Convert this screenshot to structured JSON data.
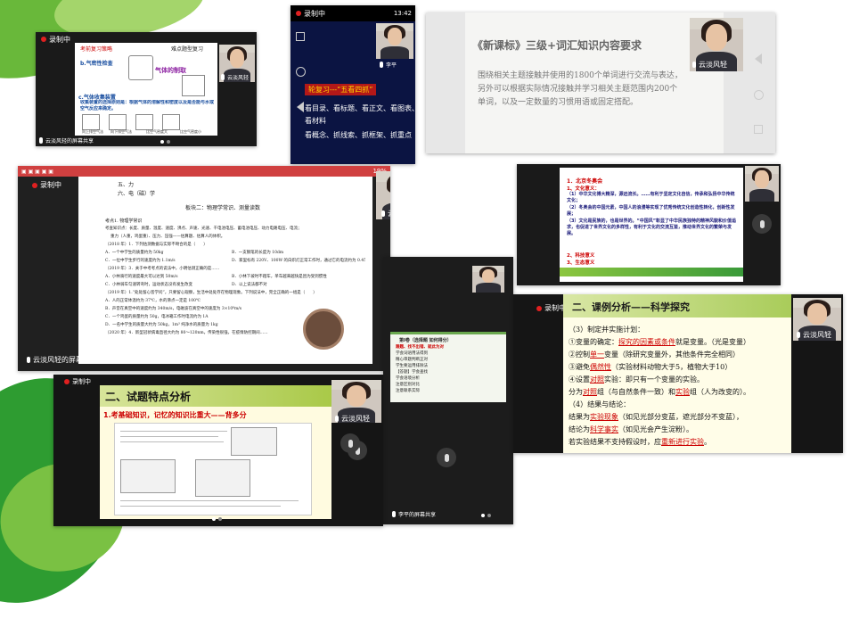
{
  "common": {
    "recording": "录制中",
    "name_wind": "云淡风轻",
    "name_li": "李平",
    "share_wind": "云淡风轻的屏幕共享",
    "share_li": "李平的屏幕共享"
  },
  "panel1": {
    "slide_left_title": "考前复习策略",
    "slide_right_title": "难点题型复习",
    "item_b": "b.气密性检查",
    "gas_title": "气体的制取",
    "item_c": "c.气体收集装置",
    "item_c2": "收集装置的选择原则是：根据气体的溶解性和密度以及是否能与水或空气反应来确定。",
    "label_a": "向上排空气法",
    "label_b": "向下排空气法",
    "label_c": "比空气密度大",
    "label_d": "比空气密度小"
  },
  "panel2": {
    "status_time": "13:42",
    "banner": "轮复习---“五看四抓”",
    "line1": "看目录、看标题、看正文、看图表、",
    "line2": "看材料",
    "line3": "看概念、抓线索、抓框架、抓重点"
  },
  "panel3": {
    "title": "《新课标》三级+词汇知识内容要求",
    "body": "围绕相关主题接触并使用的1800个单词进行交流与表达，另外可以根据实际情况接触并学习相关主题范围内200个单词，以及一定数量的习惯用语或固定搭配。"
  },
  "panel4": {
    "battery": "19%",
    "heading_small": "五、力",
    "heading_six": "六、电（磁）学",
    "block_title": "板块二：物理学常识、测量读数",
    "point": "考点1. 物理学常识",
    "l1": "考查知识点：长度、质量、温度、速度、沸点、声速、光速、干电池电压、蓄电池电压、动力电路电压、电流；",
    "l2": "重力（人重，鸡蛋重）、压力、压强——估算题、估算人的体积。",
    "l3": "（2018 年）1．下列估测数据与实际不吻合的是（　　）",
    "optA": "A．一个中学生的质量约为 50kg",
    "optB": "B．一支钢笔的长度为 10dm",
    "optC": "C．一位中学生步行的速度约为 1.1m/s",
    "optD": "D．家里标有 220V、100W 的白炽灯正常工作时，通过它的电流约为 0.45A",
    "l4": "（2019 年）3．关于中考考点的说法中，小明估测正确的是……",
    "l5": "A．小林骑行的速度最大可以达到 50m/s",
    "l6": "B．小林下坡时不蹬车，单车越来越快是因为受到惯性",
    "l7": "C．小林骑车匀速转弯时，运动状态没有发生改变",
    "l8": "D．以上说法都不对",
    "l9": "（2019 年）1.“处处留心皆学问”，只要留心观察，生活中处处存在物理现象。下列说法中，完全正确的一组是（　　）",
    "l10": "A．人的正常体温约为 37℃，水的沸点一定是 100℃",
    "l11": "B．声音在真空中的速度约为 340m/s，电磁波在真空中的速度为 3×10⁸m/s",
    "l12": "C．一个鸡蛋的质量约为 50g，电冰箱工作时电流约为 1A",
    "l13": "D．一名中学生的质量大约为 50kg，1m³ 纯净水的质量为 1kg",
    "l14": "（2020 年）4．新型冠状病毒直径大约为 80～120nm，传染性很强，在疫情防控期间……"
  },
  "panel5": {
    "title": "1．北京冬奥会",
    "l1": "1、文化意义：",
    "l2": "（1）中华文化博大精深，源远流长。……有利于坚定文化自信，传承和弘扬中华传统文化；",
    "l3": "（2）冬奥会的中国元素，中国人的浪漫等实现了优秀传统文化创造性转化，创新性发展；",
    "l4": "（3）文化是民族的，也是世界的。“中国风”彰显了中华民族独特的精神风貌和价值追求，也促进了世界文化的多样性，有利于文化的交流互鉴，推动世界文化的繁荣与发展。",
    "l5": "2、科技意义",
    "l6": "3、生态意义"
  },
  "panel6": {
    "heading": "第Ⅰ卷（选择题 如何得分）",
    "items": [
      "跟题、找不出错、就此为对",
      "学会词语用法得到",
      "精心审题判断正对",
      "学生要运用排除法",
      "【答题】学会查找",
      "学会语境分析",
      "注意区别对比",
      "注意联系实际"
    ]
  },
  "panel7": {
    "title": "二、课例分析——科学探究",
    "l1": "（3）制定并实施计划：",
    "l2a": "①变量的确定：",
    "l2b": "探究的因素或条件",
    "l2c": "就是变量。（光是变量）",
    "l3a": "②控制",
    "l3b": "单一",
    "l3c": "变量（除研究变量外，其他条件完全相同）",
    "l4a": "③避免",
    "l4b": "偶然性",
    "l4c": "（实验材料动物大于5，植物大于10）",
    "l5a": "④设置",
    "l5b": "对照",
    "l5c": "实验：即只有一个变量的实验。",
    "l6a": "分为",
    "l6b": "对照",
    "l6c": "组（与自然条件一致）和",
    "l6d": "实验",
    "l6e": "组（人为改变的）。",
    "l7": "（4）结果与结论：",
    "l8a": "结果为",
    "l8b": "实验现象",
    "l8c": "（如见光部分变蓝，遮光部分不变蓝），",
    "l9a": "结论为",
    "l9b": "科学事实",
    "l9c": "（如见光会产生淀粉）。",
    "l10a": "若实验结果不支持假设时，应",
    "l10b": "重新进行实验",
    "l10c": "。"
  },
  "panel8": {
    "title": "二、试题特点分析",
    "subtitle": "1.考基础知识，记忆的知识比重大——背多分"
  }
}
